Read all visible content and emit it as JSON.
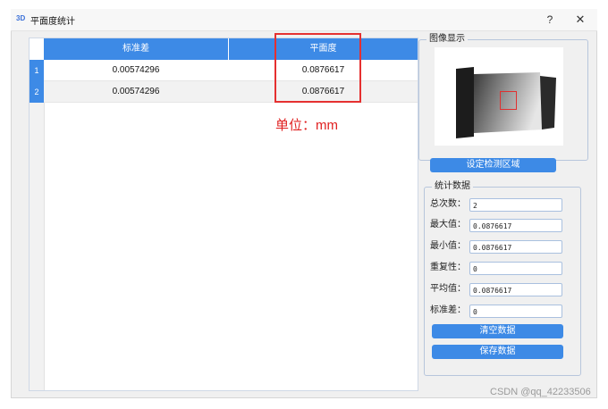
{
  "window": {
    "icon_text": "3D",
    "title": "平面度统计",
    "help_label": "?",
    "close_label": "✕"
  },
  "table": {
    "columns": [
      "标准差",
      "平面度"
    ],
    "rows": [
      {
        "index": "1",
        "std": "0.00574296",
        "flatness": "0.0876617"
      },
      {
        "index": "2",
        "std": "0.00574296",
        "flatness": "0.0876617"
      }
    ]
  },
  "annotation": {
    "unit": "单位：mm"
  },
  "image_panel": {
    "title": "图像显示",
    "set_roi_label": "设定检测区域"
  },
  "stats": {
    "title": "统计数据",
    "fields": [
      {
        "label": "总次数：",
        "value": "2"
      },
      {
        "label": "最大值：",
        "value": "0.0876617"
      },
      {
        "label": "最小值：",
        "value": "0.0876617"
      },
      {
        "label": "重复性：",
        "value": "0"
      },
      {
        "label": "平均值：",
        "value": "0.0876617"
      },
      {
        "label": "标准差：",
        "value": "0"
      }
    ],
    "clear_label": "清空数据",
    "save_label": "保存数据"
  },
  "watermark": "CSDN @qq_42233506",
  "colors": {
    "accent": "#3d8ae6",
    "annotation_red": "#e53030"
  }
}
